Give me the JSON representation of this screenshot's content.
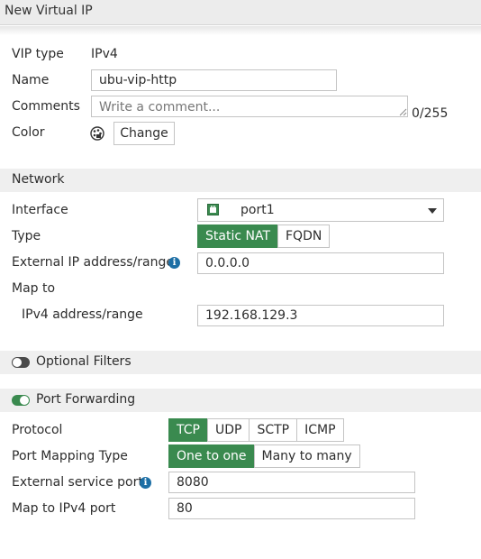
{
  "window": {
    "title": "New Virtual IP"
  },
  "general": {
    "vip_type_label": "VIP type",
    "vip_type_value": "IPv4",
    "name_label": "Name",
    "name_value": "ubu-vip-http",
    "comments_label": "Comments",
    "comments_placeholder": "Write a comment...",
    "comments_counter": "0/255",
    "color_label": "Color",
    "color_icon": "palette-icon",
    "change_label": "Change"
  },
  "network": {
    "section_title": "Network",
    "interface_label": "Interface",
    "interface_value": "port1",
    "interface_icon": "network-port-icon",
    "type_label": "Type",
    "type_options": [
      "Static NAT",
      "FQDN"
    ],
    "type_selected": "Static NAT",
    "external_ip_label": "External IP address/range",
    "external_ip_value": "0.0.0.0",
    "map_to_label": "Map to",
    "ipv4_range_label": "IPv4 address/range",
    "ipv4_range_value": "192.168.129.3"
  },
  "optional_filters": {
    "label": "Optional Filters",
    "enabled": false
  },
  "port_forwarding": {
    "label": "Port Forwarding",
    "enabled": true,
    "protocol_label": "Protocol",
    "protocol_options": [
      "TCP",
      "UDP",
      "SCTP",
      "ICMP"
    ],
    "protocol_selected": "TCP",
    "mapping_type_label": "Port Mapping Type",
    "mapping_options": [
      "One to one",
      "Many to many"
    ],
    "mapping_selected": "One to one",
    "external_port_label": "External service port",
    "external_port_value": "8080",
    "map_port_label": "Map to IPv4 port",
    "map_port_value": "80"
  },
  "colors": {
    "accent": "#3a8a4f",
    "info": "#1d6fa5",
    "section_bg": "#efefef"
  }
}
